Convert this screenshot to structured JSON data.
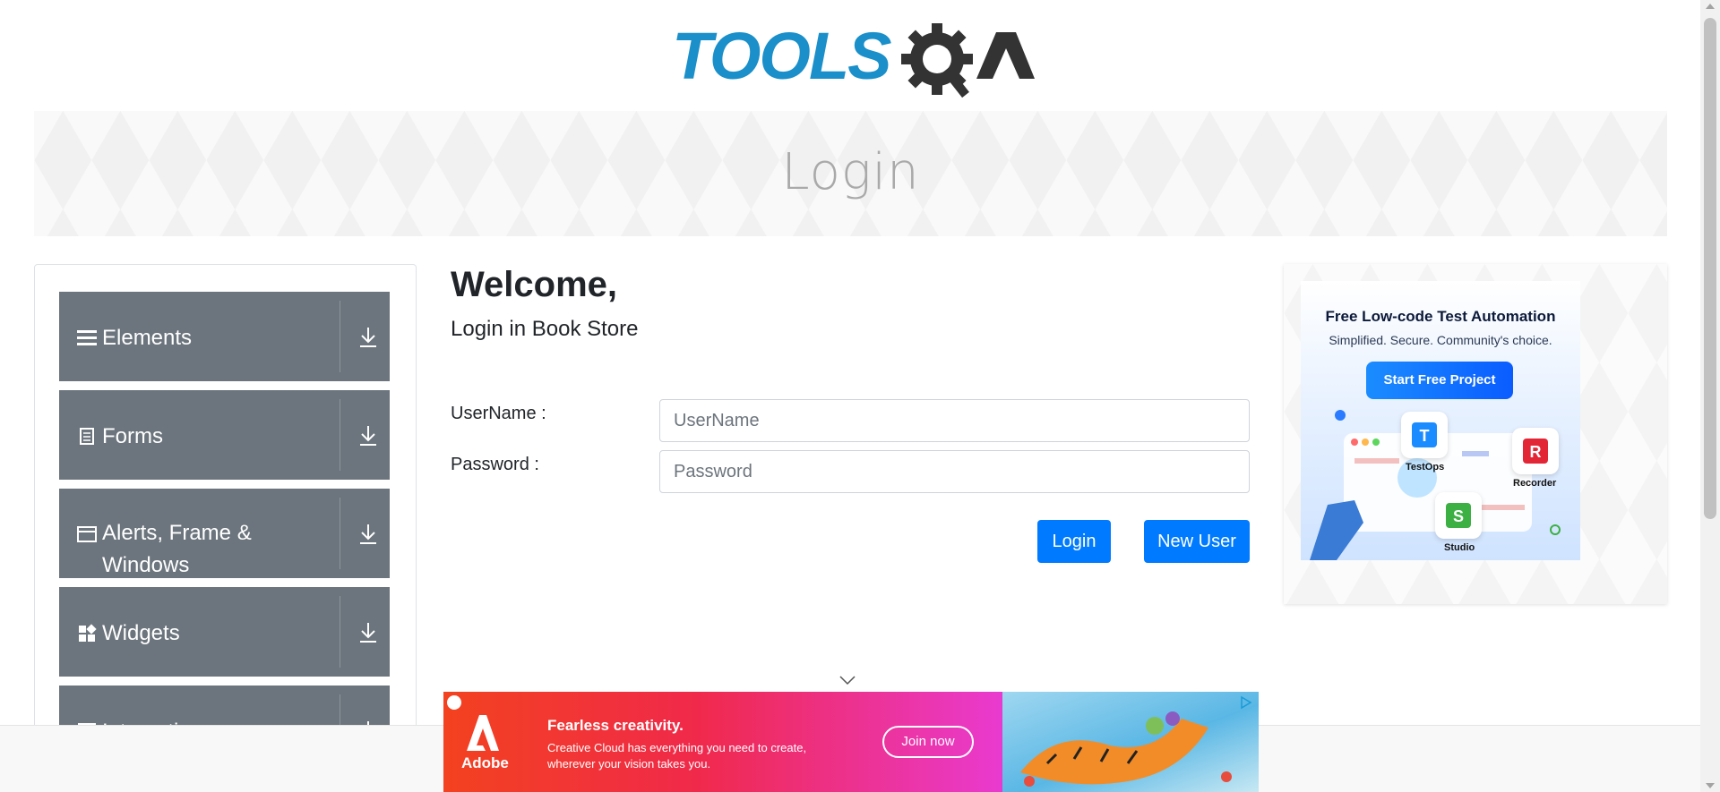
{
  "header": {
    "logo_text": "TOOLSQA"
  },
  "banner": {
    "title": "Login"
  },
  "sidebar": {
    "groups": [
      {
        "label": "Elements",
        "icon": "hamburger-icon"
      },
      {
        "label": "Forms",
        "icon": "document-icon"
      },
      {
        "label": "Alerts, Frame &",
        "label2": "Windows",
        "icon": "window-icon"
      },
      {
        "label": "Widgets",
        "icon": "widgets-icon"
      },
      {
        "label": "Interactions",
        "icon": "interactions-icon"
      }
    ]
  },
  "main": {
    "welcome": "Welcome,",
    "subtitle": "Login in Book Store",
    "username_label": "UserName :",
    "username_placeholder": "UserName",
    "password_label": "Password :",
    "password_placeholder": "Password",
    "login_button": "Login",
    "new_user_button": "New User"
  },
  "right_ad": {
    "title": "Free Low-code Test Automation",
    "subtitle": "Simplified. Secure. Community's choice.",
    "cta": "Start Free Project",
    "tiles": [
      "TestOps",
      "Recorder",
      "Studio"
    ]
  },
  "bottom_ad": {
    "brand": "Adobe",
    "headline": "Fearless creativity.",
    "body": "Creative Cloud has everything you need to create, wherever your vision takes you.",
    "cta": "Join now"
  },
  "colors": {
    "primary": "#007bff",
    "menu_bg": "#6c757d",
    "logo_blue": "#1a8fc9",
    "logo_dark": "#333333"
  }
}
